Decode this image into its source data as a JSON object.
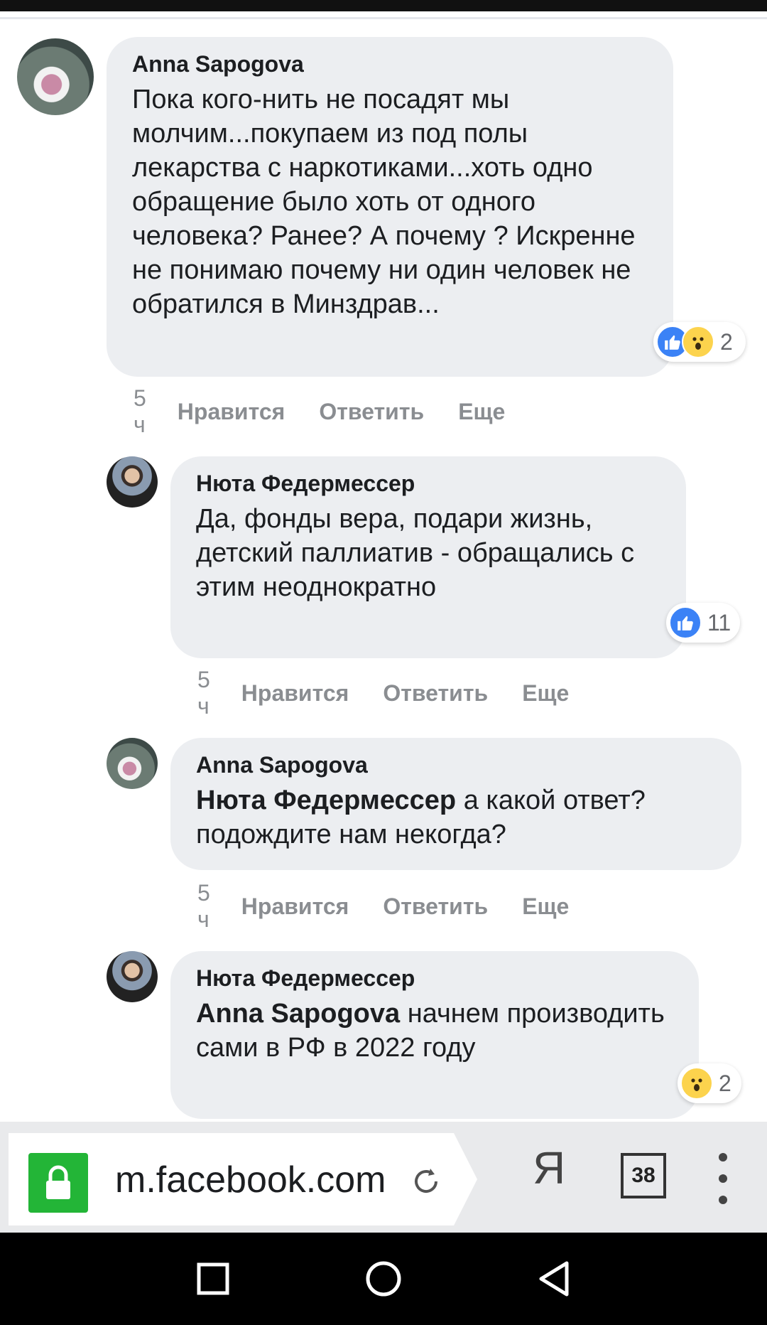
{
  "comments": [
    {
      "author": "Anna Sapogova",
      "mention": "",
      "text": "Пока кого-нить не посадят мы молчим...покупаем из под полы лекарства с наркотиками...хоть одно обращение было хоть от одного человека? Ранее? А почему ? Искренне не понимаю почему ни один человек не обратился в Минздрав...",
      "time": "5 ч",
      "like_label": "Нравится",
      "reply_label": "Ответить",
      "more_label": "Еще",
      "reactions": [
        "like-icon",
        "wow-icon"
      ],
      "reaction_count": "2"
    },
    {
      "author": "Нюта Федермессер",
      "mention": "",
      "text": "Да, фонды вера, подари жизнь, детский паллиатив - обращались с этим неоднократно",
      "time": "5 ч",
      "like_label": "Нравится",
      "reply_label": "Ответить",
      "more_label": "Еще",
      "reactions": [
        "like-icon"
      ],
      "reaction_count": "11"
    },
    {
      "author": "Anna Sapogova",
      "mention": "Нюта Федермессер",
      "text": " а какой ответ? подождите нам некогда?",
      "time": "5 ч",
      "like_label": "Нравится",
      "reply_label": "Ответить",
      "more_label": "Еще"
    },
    {
      "author": "Нюта Федермессер",
      "mention": "Anna Sapogova",
      "text": " начнем производить сами в РФ в 2022 году",
      "reactions": [
        "wow-icon"
      ],
      "reaction_count": "2"
    }
  ],
  "browser": {
    "url": "m.facebook.com",
    "search_engine_label": "Я",
    "tab_count": "38",
    "lock_color": "#23b537"
  },
  "colors": {
    "bubble": "#eceef1",
    "meta_text": "#8a8d91",
    "like_blue": "#3b82f6",
    "wow_yellow": "#fcd34d"
  }
}
